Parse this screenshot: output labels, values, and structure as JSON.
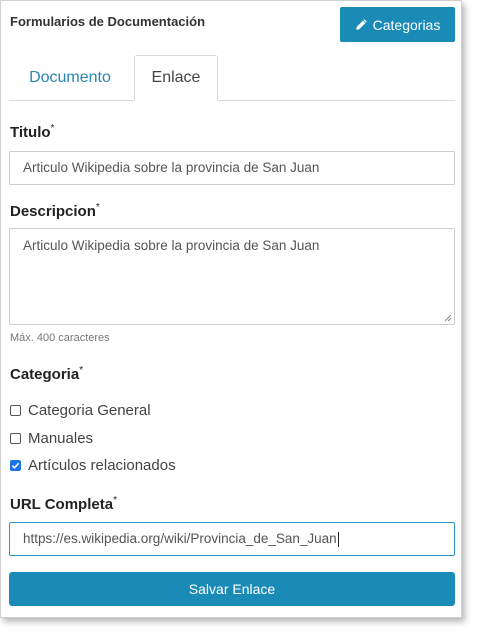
{
  "header": {
    "title": "Formularios de Documentación",
    "categories_button": "Categorias",
    "categories_icon": "pencil-icon"
  },
  "tabs": [
    {
      "label": "Documento",
      "active": false
    },
    {
      "label": "Enlace",
      "active": true
    }
  ],
  "form": {
    "titulo": {
      "label": "Titulo",
      "required_mark": "*",
      "value": "Articulo Wikipedia sobre la provincia de San Juan"
    },
    "descripcion": {
      "label": "Descripcion",
      "required_mark": "*",
      "value": "Articulo Wikipedia sobre la provincia de San Juan",
      "hint": "Máx. 400 caracteres"
    },
    "categoria": {
      "label": "Categoria",
      "required_mark": "*",
      "options": [
        {
          "label": "Categoria General",
          "checked": false
        },
        {
          "label": "Manuales",
          "checked": false
        },
        {
          "label": "Artículos relacionados",
          "checked": true
        }
      ]
    },
    "url": {
      "label": "URL Completa",
      "required_mark": "*",
      "value": "https://es.wikipedia.org/wiki/Provincia_de_San_Juan"
    },
    "submit_label": "Salvar Enlace"
  },
  "colors": {
    "primary": "#1a8bb6",
    "tab_link": "#2a86b3",
    "checkbox_checked": "#1a73e8"
  }
}
